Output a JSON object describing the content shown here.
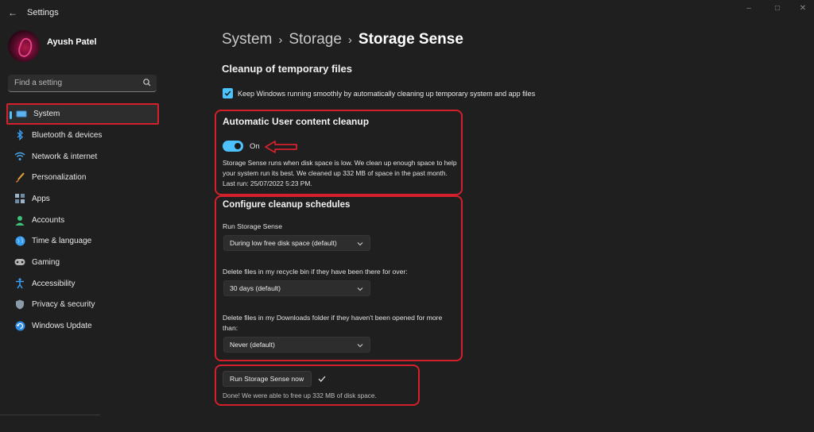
{
  "window": {
    "title": "Settings"
  },
  "profile": {
    "name": "Ayush Patel"
  },
  "search": {
    "placeholder": "Find a setting"
  },
  "sidebar": {
    "items": [
      {
        "label": "System",
        "icon": "system-icon"
      },
      {
        "label": "Bluetooth & devices",
        "icon": "bluetooth-icon"
      },
      {
        "label": "Network & internet",
        "icon": "wifi-icon"
      },
      {
        "label": "Personalization",
        "icon": "brush-icon"
      },
      {
        "label": "Apps",
        "icon": "apps-icon"
      },
      {
        "label": "Accounts",
        "icon": "accounts-icon"
      },
      {
        "label": "Time & language",
        "icon": "globe-icon"
      },
      {
        "label": "Gaming",
        "icon": "gamepad-icon"
      },
      {
        "label": "Accessibility",
        "icon": "accessibility-icon"
      },
      {
        "label": "Privacy & security",
        "icon": "shield-icon"
      },
      {
        "label": "Windows Update",
        "icon": "update-icon"
      }
    ]
  },
  "breadcrumb": {
    "part1": "System",
    "part2": "Storage",
    "current": "Storage Sense"
  },
  "cleanup": {
    "title": "Cleanup of temporary files",
    "keep_text": "Keep Windows running smoothly by automatically cleaning up temporary system and app files"
  },
  "auto_cleanup": {
    "title": "Automatic User content cleanup",
    "toggle_label": "On",
    "description": "Storage Sense runs when disk space is low. We clean up enough space to help your system run its best. We cleaned up 332 MB of space in the past month. Last run: 25/07/2022 5:23 PM."
  },
  "schedules": {
    "title": "Configure cleanup schedules",
    "run_label": "Run Storage Sense",
    "run_value": "During low free disk space (default)",
    "recycle_label": "Delete files in my recycle bin if they have been there for over:",
    "recycle_value": "30 days (default)",
    "downloads_label": "Delete files in my Downloads folder if they haven't been opened for more than:",
    "downloads_value": "Never (default)"
  },
  "run_now": {
    "button_label": "Run Storage Sense now",
    "done_text": "Done! We were able to free up 332 MB of disk space."
  },
  "colors": {
    "accent": "#4cc2ff",
    "highlight": "#d3202c",
    "background": "#1f1f1f"
  }
}
